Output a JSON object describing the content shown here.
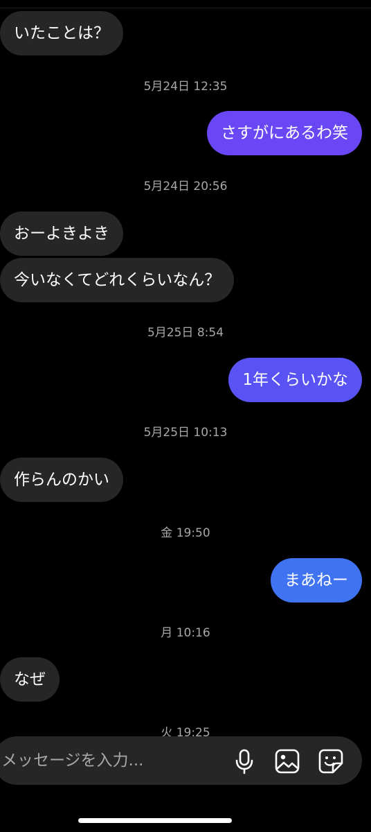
{
  "messages": [
    {
      "kind": "in",
      "text": "いたことは？"
    },
    {
      "kind": "timestamp",
      "text": "5月24日 12:35"
    },
    {
      "kind": "out",
      "text": "さすがにあるわ笑",
      "color": "#6a47f4"
    },
    {
      "kind": "timestamp",
      "text": "5月24日 20:56"
    },
    {
      "kind": "in",
      "text": "おーよきよき"
    },
    {
      "kind": "in",
      "text": "今いなくてどれくらいなん？"
    },
    {
      "kind": "timestamp",
      "text": "5月25日 8:54"
    },
    {
      "kind": "out",
      "text": "1年くらいかな",
      "color": "#5853f2"
    },
    {
      "kind": "timestamp",
      "text": "5月25日 10:13"
    },
    {
      "kind": "in",
      "text": "作らんのかい"
    },
    {
      "kind": "timestamp",
      "text": "金 19:50"
    },
    {
      "kind": "out",
      "text": "まあねー",
      "color": "#3f73f2"
    },
    {
      "kind": "timestamp",
      "text": "月 10:16"
    },
    {
      "kind": "in",
      "text": "なぜ"
    },
    {
      "kind": "timestamp",
      "text": "火 19:25"
    }
  ],
  "composer": {
    "placeholder": "メッセージを入力...",
    "buttons": [
      "microphone-icon",
      "gallery-icon",
      "sticker-icon"
    ]
  },
  "colors": {
    "background": "#000000",
    "incoming_bubble": "#262626",
    "timestamp_text": "#a8a8a8",
    "composer_background": "#262626"
  }
}
